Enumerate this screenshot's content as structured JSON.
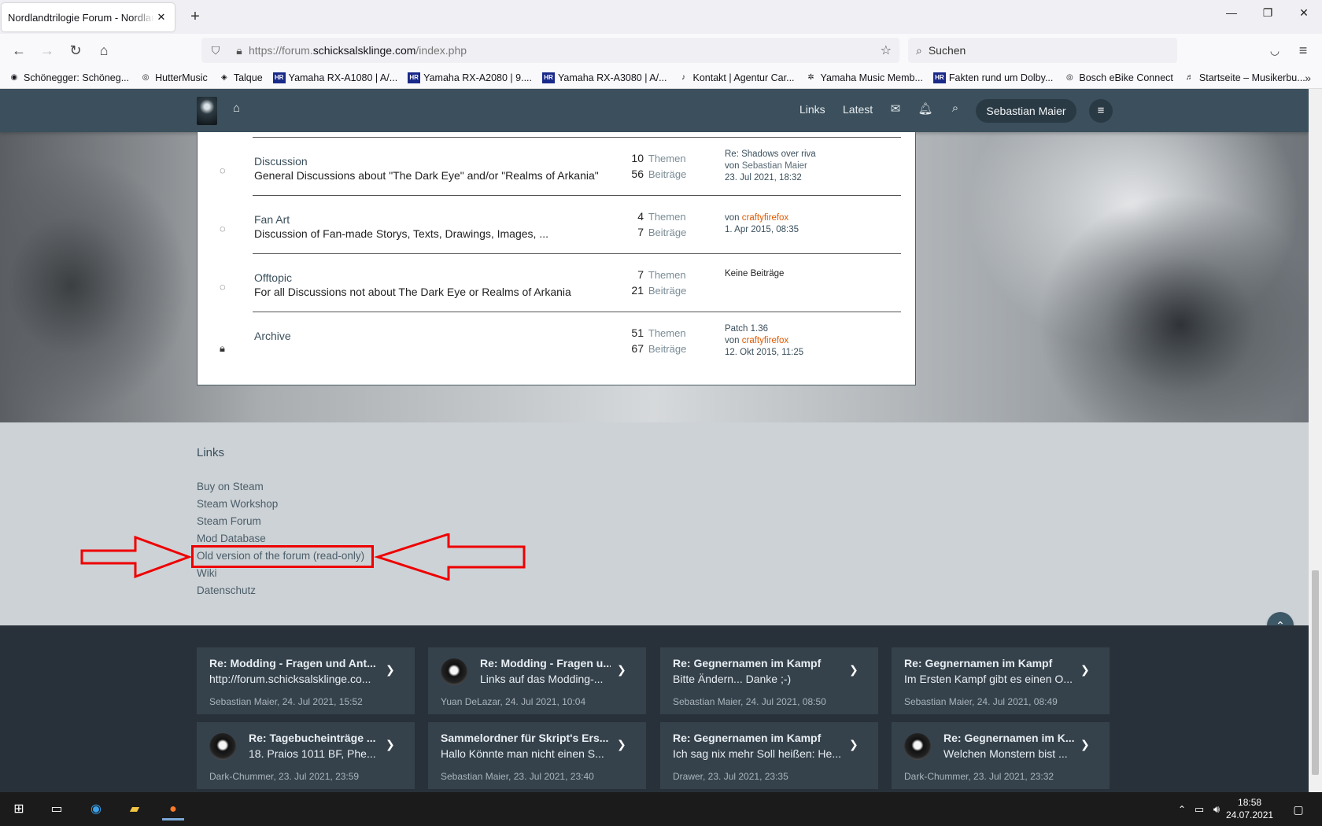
{
  "browser": {
    "tab_title": "Nordlandtrilogie Forum - Nordlandtrilogie",
    "tab_close": "✕",
    "new_tab": "+",
    "url_prefix": "https://forum.",
    "url_domain": "schicksalsklinge.com",
    "url_path": "/index.php",
    "search_placeholder": "Suchen",
    "bookmarks": [
      {
        "icon": "record",
        "label": "Schönegger: Schöneg..."
      },
      {
        "icon": "globe",
        "label": "HutterMusic"
      },
      {
        "icon": "talque",
        "label": "Talque"
      },
      {
        "icon": "HR",
        "label": "Yamaha RX-A1080 | A/..."
      },
      {
        "icon": "HR",
        "label": "Yamaha RX-A2080 | 9...."
      },
      {
        "icon": "HR",
        "label": "Yamaha RX-A3080 | A/..."
      },
      {
        "icon": "leaf",
        "label": "Kontakt | Agentur Car..."
      },
      {
        "icon": "yamaha",
        "label": "Yamaha Music Memb..."
      },
      {
        "icon": "HR",
        "label": "Fakten rund um Dolby..."
      },
      {
        "icon": "globe",
        "label": "Bosch eBike Connect"
      },
      {
        "icon": "music",
        "label": "Startseite – Musikerbu..."
      }
    ]
  },
  "header": {
    "nav_links": [
      "Links",
      "Latest"
    ],
    "user_name": "Sebastian Maier",
    "accent": "#3b4f5c"
  },
  "boards": [
    {
      "icon": "speech-bubble",
      "title": "Discussion",
      "description": "General Discussions about \"The Dark Eye\" and/or \"Realms of Arkania\"",
      "topics": "10",
      "posts": "56",
      "last_title": "Re: Shadows over riva",
      "last_by_prefix": "von",
      "last_user": "Sebastian Maier",
      "last_date": "23. Jul 2021, 18:32"
    },
    {
      "icon": "speech-bubble",
      "title": "Fan Art",
      "description": "Discussion of Fan-made Storys, Texts, Drawings, Images, ...",
      "topics": "4",
      "posts": "7",
      "last_title": "",
      "last_by_prefix": "von",
      "last_user": "craftyfirefox",
      "last_date": "1. Apr 2015, 08:35"
    },
    {
      "icon": "speech-bubble",
      "title": "Offtopic",
      "description": "For all Discussions not about The Dark Eye or Realms of Arkania",
      "topics": "7",
      "posts": "21",
      "last_title": "Keine Beiträge",
      "last_by_prefix": "",
      "last_user": "",
      "last_date": ""
    },
    {
      "icon": "lock",
      "title": "Archive",
      "description": "",
      "topics": "51",
      "posts": "67",
      "last_title": "Patch 1.36",
      "last_by_prefix": "von",
      "last_user": "craftyfirefox",
      "last_date": "12. Okt 2015, 11:25"
    }
  ],
  "labels": {
    "topics": "Themen",
    "posts": "Beiträge"
  },
  "links_section": {
    "heading": "Links",
    "items": [
      "Buy on Steam",
      "Steam Workshop",
      "Steam Forum",
      "Mod Database",
      "Old version of the forum (read-only)",
      "Wiki",
      "Datenschutz"
    ],
    "annotation_color": "#e00000"
  },
  "latest_posts": [
    {
      "title": "Re: Modding - Fragen und Ant...",
      "snippet": "http://forum.schicksalsklinge.co...",
      "meta": "Sebastian Maier, 24. Jul 2021, 15:52",
      "avatar": false
    },
    {
      "title": "Re: Modding - Fragen u...",
      "snippet": "Links auf das Modding-...",
      "meta": "Yuan DeLazar, 24. Jul 2021, 10:04",
      "avatar": true
    },
    {
      "title": "Re: Gegnernamen im Kampf",
      "snippet": "Bitte Ändern... Danke ;-)",
      "meta": "Sebastian Maier, 24. Jul 2021, 08:50",
      "avatar": false
    },
    {
      "title": "Re: Gegnernamen im Kampf",
      "snippet": "Im Ersten Kampf gibt es einen O...",
      "meta": "Sebastian Maier, 24. Jul 2021, 08:49",
      "avatar": false
    },
    {
      "title": "Re: Tagebucheinträge ...",
      "snippet": "18. Praios 1011 BF, Phe...",
      "meta": "Dark-Chummer, 23. Jul 2021, 23:59",
      "avatar": true
    },
    {
      "title": "Sammelordner für Skript's Ers...",
      "snippet": "Hallo Könnte man nicht einen S...",
      "meta": "Sebastian Maier, 23. Jul 2021, 23:40",
      "avatar": false
    },
    {
      "title": "Re: Gegnernamen im Kampf",
      "snippet": "Ich sag nix mehr Soll heißen: He...",
      "meta": "Drawer, 23. Jul 2021, 23:35",
      "avatar": false
    },
    {
      "title": "Re: Gegnernamen im K...",
      "snippet": "Welchen Monstern bist ...",
      "meta": "Dark-Chummer, 23. Jul 2021, 23:32",
      "avatar": true
    }
  ],
  "taskbar": {
    "time": "18:58",
    "date": "24.07.2021"
  }
}
